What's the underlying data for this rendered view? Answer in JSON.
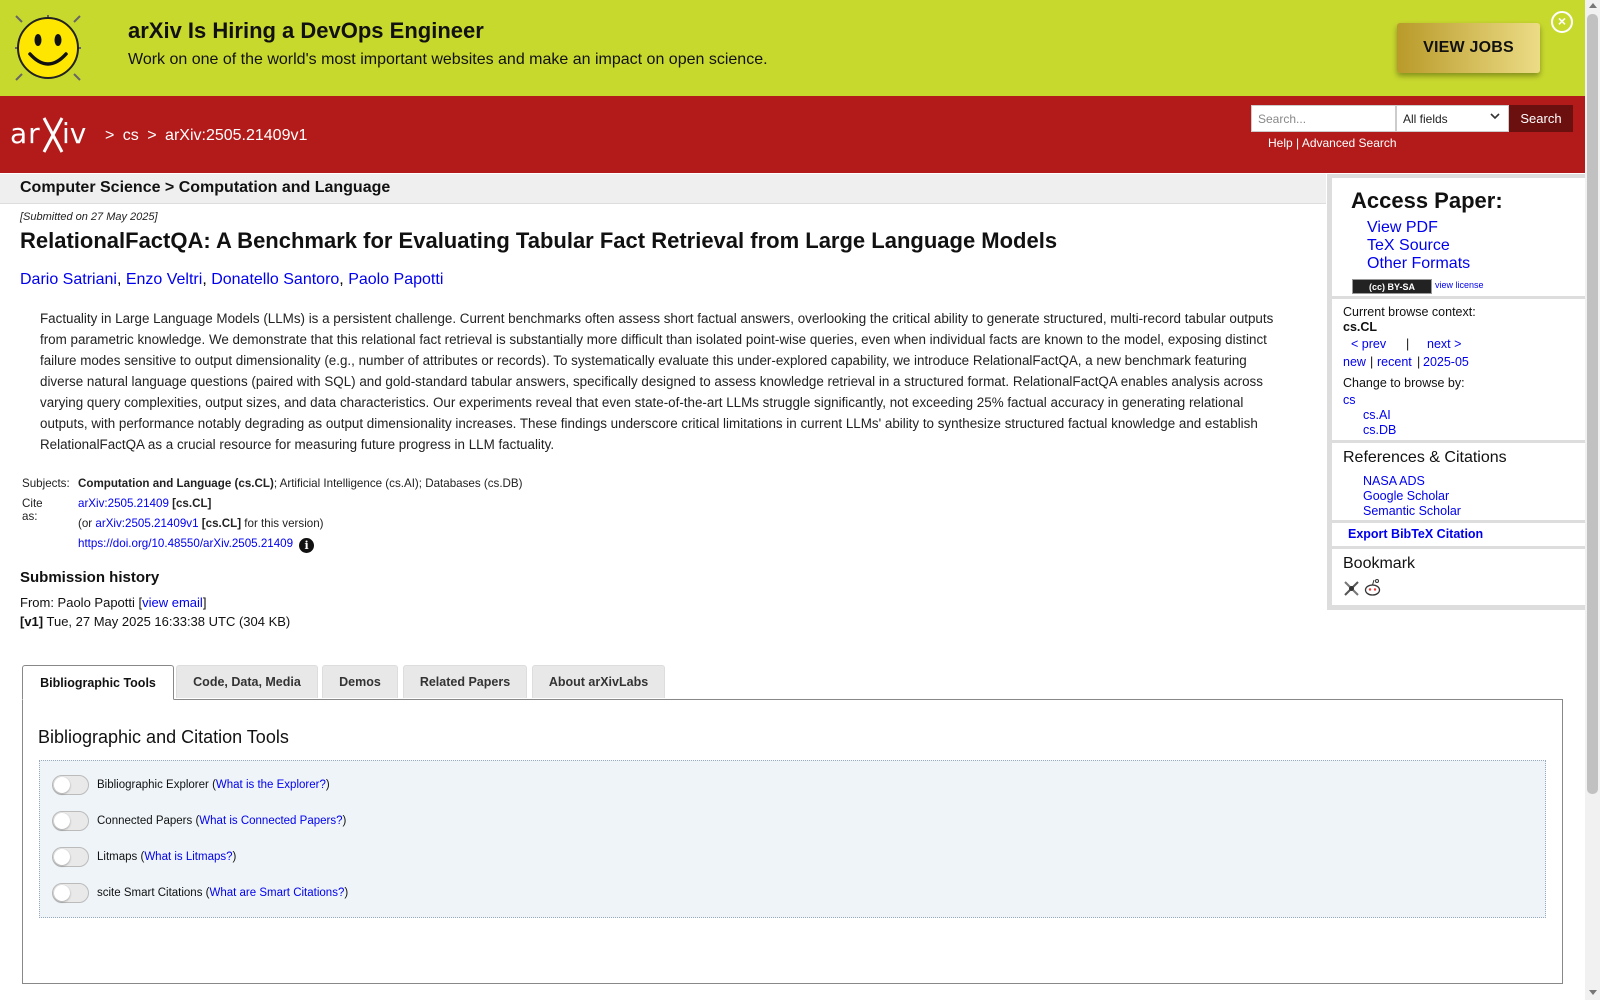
{
  "banner": {
    "title": "arXiv Is Hiring a DevOps Engineer",
    "subtitle": "Work on one of the world's most important websites and make an impact on open science.",
    "cta": "VIEW JOBS",
    "close_icon": "close-circle-icon",
    "colors": {
      "background": "#c8d92e"
    }
  },
  "header": {
    "logo_text": "arXiv",
    "breadcrumbs": [
      ">",
      "cs",
      ">",
      "arXiv:2505.21409v1"
    ],
    "search": {
      "placeholder": "Search...",
      "field_select": "All fields",
      "button": "Search",
      "help": "Help",
      "separator": "|",
      "advanced": "Advanced Search"
    },
    "colors": {
      "background": "#b31b1b"
    }
  },
  "main": {
    "category_crumb": "Computer Science > Computation and Language",
    "submitted": "[Submitted on 27 May 2025]",
    "title": "RelationalFactQA: A Benchmark for Evaluating Tabular Fact Retrieval from Large Language Models",
    "authors": [
      "Dario Satriani",
      "Enzo Veltri",
      "Donatello Santoro",
      "Paolo Papotti"
    ],
    "abstract": "Factuality in Large Language Models (LLMs) is a persistent challenge. Current benchmarks often assess short factual answers, overlooking the critical ability to generate structured, multi-record tabular outputs from parametric knowledge. We demonstrate that this relational fact retrieval is substantially more difficult than isolated point-wise queries, even when individual facts are known to the model, exposing distinct failure modes sensitive to output dimensionality (e.g., number of attributes or records). To systematically evaluate this under-explored capability, we introduce RelationalFactQA, a new benchmark featuring diverse natural language questions (paired with SQL) and gold-standard tabular answers, specifically designed to assess knowledge retrieval in a structured format. RelationalFactQA enables analysis across varying query complexities, output sizes, and data characteristics. Our experiments reveal that even state-of-the-art LLMs struggle significantly, not exceeding 25% factual accuracy in generating relational outputs, with performance notably degrading as output dimensionality increases. These findings underscore critical limitations in current LLMs' ability to synthesize structured factual knowledge and establish RelationalFactQA as a crucial resource for measuring future progress in LLM factuality.",
    "meta": {
      "subjects_label": "Subjects:",
      "subjects_primary": "Computation and Language (cs.CL)",
      "subjects_rest": "; Artificial Intelligence (cs.AI); Databases (cs.DB)",
      "cite_label": "Cite as:",
      "cite_id": "arXiv:2505.21409",
      "cite_cat": "[cs.CL]",
      "cite_or_prefix": "(or ",
      "cite_version_id": "arXiv:2505.21409v1",
      "cite_version_suffix": " for this version)",
      "doi": "https://doi.org/10.48550/arXiv.2505.21409",
      "info_icon": "info-icon"
    },
    "history": {
      "title": "Submission history",
      "from_prefix": "From: Paolo Papotti [",
      "view_email": "view email",
      "from_suffix": "]",
      "version_label": "[v1]",
      "version_text": " Tue, 27 May 2025 16:33:38 UTC (304 KB)"
    }
  },
  "sidebar": {
    "access_title": "Access Paper:",
    "access_links": [
      "View PDF",
      "TeX Source",
      "Other Formats"
    ],
    "license_badge": "(cc) BY-SA",
    "view_license": "view license",
    "browse_context_label": "Current browse context:",
    "browse_context": "cs.CL",
    "prev": "< prev",
    "pipe": "|",
    "next": "next >",
    "new": "new",
    "recent": "recent",
    "month": "2025-05",
    "change_browse": "Change to browse by:",
    "browse_cats": [
      "cs",
      "cs.AI",
      "cs.DB"
    ],
    "refs_title": "References & Citations",
    "refs_links": [
      "NASA ADS",
      "Google Scholar",
      "Semantic Scholar"
    ],
    "export_bibtex": "Export BibTeX Citation",
    "bookmark_title": "Bookmark",
    "bookmark_icons": [
      "bibsonomy-icon",
      "reddit-icon"
    ]
  },
  "tabs": {
    "items": [
      "Bibliographic Tools",
      "Code, Data, Media",
      "Demos",
      "Related Papers",
      "About arXivLabs"
    ],
    "active": "Bibliographic Tools",
    "panel_title": "Bibliographic and Citation Tools",
    "tools": [
      {
        "label": "Bibliographic Explorer",
        "link": "What is the Explorer?",
        "enabled": false
      },
      {
        "label": "Connected Papers",
        "link": "What is Connected Papers?",
        "enabled": false
      },
      {
        "label": "Litmaps",
        "link": "What is Litmaps?",
        "enabled": false
      },
      {
        "label": "scite Smart Citations",
        "link": "What are Smart Citations?",
        "enabled": false
      }
    ]
  }
}
